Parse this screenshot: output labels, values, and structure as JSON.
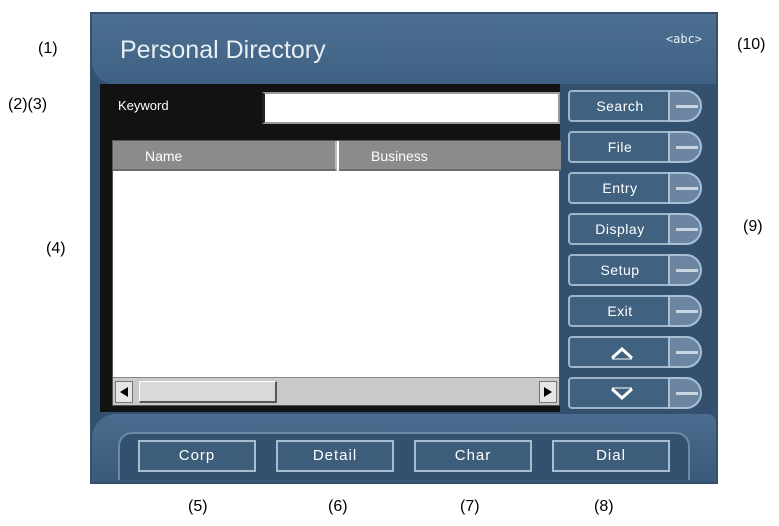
{
  "callouts": {
    "c1": "(1)",
    "c23": "(2)(3)",
    "c4": "(4)",
    "c5": "(5)",
    "c6": "(6)",
    "c7": "(7)",
    "c8": "(8)",
    "c9": "(9)",
    "c10": "(10)"
  },
  "header": {
    "title": "Personal Directory",
    "mode": "<abc>"
  },
  "search": {
    "label": "Keyword",
    "value": ""
  },
  "list": {
    "columns": [
      "Name",
      "Business"
    ],
    "rows": []
  },
  "side_buttons": [
    {
      "label": "Search"
    },
    {
      "label": "File"
    },
    {
      "label": "Entry"
    },
    {
      "label": "Display"
    },
    {
      "label": "Setup"
    },
    {
      "label": "Exit"
    },
    {
      "label": "",
      "icon": "chevron-up-icon"
    },
    {
      "label": "",
      "icon": "chevron-down-icon"
    }
  ],
  "bottom_buttons": [
    "Corp",
    "Detail",
    "Char",
    "Dial"
  ],
  "colors": {
    "panel": "#33506e",
    "title_bar": "#4c6f92",
    "button_face": "#40617f",
    "list_header": "#8b8b8b"
  }
}
